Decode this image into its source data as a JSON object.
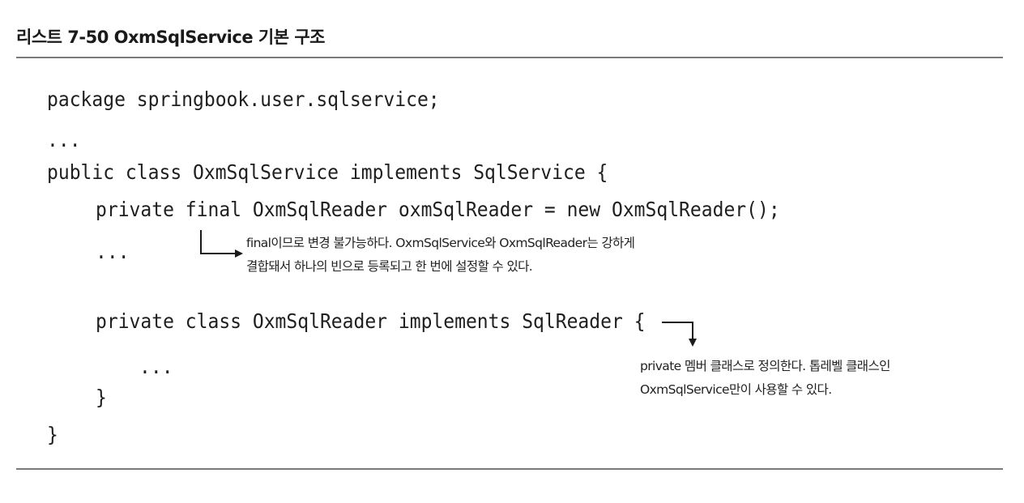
{
  "listing": {
    "title": "리스트 7-50 OxmSqlService 기본 구조"
  },
  "code": {
    "lines": [
      "package springbook.user.sqlservice;",
      "...",
      "public class OxmSqlService implements SqlService {",
      "private final OxmSqlReader oxmSqlReader = new OxmSqlReader();",
      "...",
      "private class OxmSqlReader implements SqlReader {",
      "...",
      "}",
      "}"
    ]
  },
  "annotations": {
    "final_note": {
      "line1": "final이므로 변경 불가능하다. OxmSqlService와 OxmSqlReader는 강하게",
      "line2": "결합돼서 하나의 빈으로 등록되고 한 번에 설정할 수 있다."
    },
    "private_note": {
      "line1": "private 멤버 클래스로 정의한다. 톱레벨 클래스인",
      "line2": "OxmSqlService만이 사용할 수 있다."
    }
  }
}
